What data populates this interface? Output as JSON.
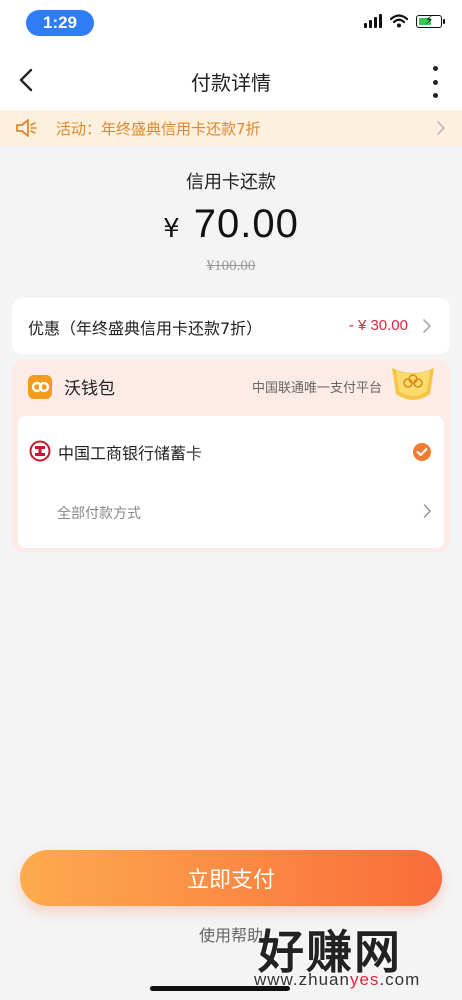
{
  "status_bar": {
    "time": "1:29",
    "icons": [
      "signal-icon",
      "wifi-icon",
      "battery-charging-icon"
    ]
  },
  "nav": {
    "title": "付款详情",
    "back_icon": "chevron-left-icon",
    "more_icon": "more-vertical-icon"
  },
  "promo": {
    "text": "活动：年终盛典信用卡还款7折",
    "icon": "speaker-icon",
    "color": "#e2872e"
  },
  "payment": {
    "title": "信用卡还款",
    "currency": "¥",
    "amount": "70.00",
    "original_amount": "¥100.00"
  },
  "discount": {
    "label": "优惠（年终盛典信用卡还款7折）",
    "value": "- ¥ 30.00",
    "value_color": "#e0243a"
  },
  "wallet": {
    "name": "沃钱包",
    "slogan": "中国联通唯一支付平台",
    "accent": "#f59a1d",
    "selected_method": "中国工商银行储蓄卡",
    "all_methods_label": "全部付款方式"
  },
  "actions": {
    "pay_button": "立即支付",
    "help_link": "使用帮助"
  },
  "watermark": {
    "main": "好赚网",
    "sub_prefix": "www.zhuan",
    "sub_highlight": "yes",
    "sub_suffix": ".com"
  }
}
